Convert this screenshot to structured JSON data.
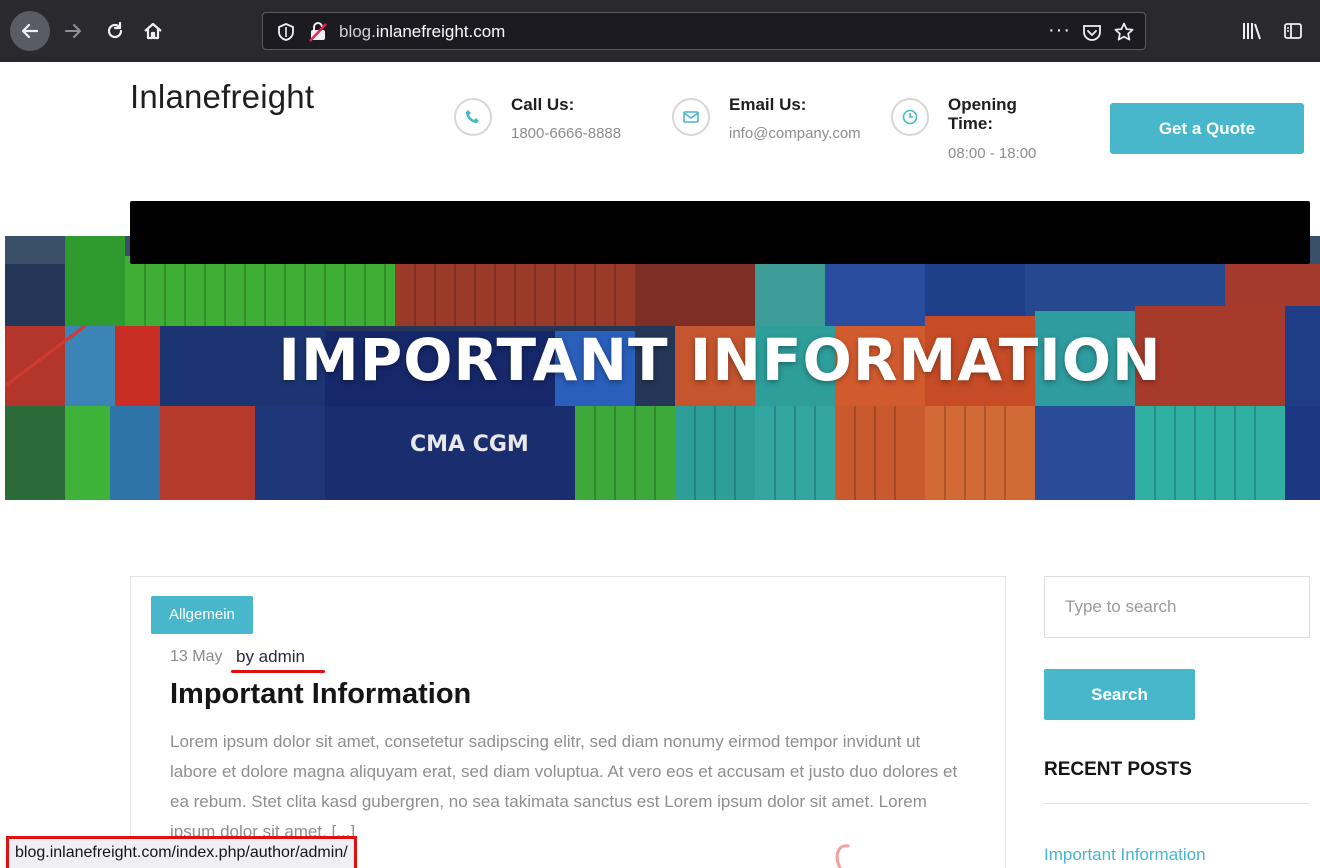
{
  "browser": {
    "url_prefix": "blog.",
    "url_domain": "inlanefreight.com",
    "more_label": "···"
  },
  "site": {
    "brand": "Inlanefreight",
    "contact": [
      {
        "title": "Call Us:",
        "value": "1800-6666-8888",
        "icon": "phone-icon"
      },
      {
        "title": "Email Us:",
        "value": "info@company.com",
        "icon": "mail-icon"
      },
      {
        "title": "Opening Time:",
        "value": "08:00 - 18:00",
        "icon": "clock-icon"
      }
    ],
    "quote_label": "Get a Quote"
  },
  "hero": {
    "title": "IMPORTANT INFORMATION",
    "container_text": "CMA CGM"
  },
  "post": {
    "category": "Allgemein",
    "date": "13 May",
    "author": "by admin",
    "title": "Important Information",
    "excerpt": "Lorem ipsum dolor sit amet, consetetur sadipscing elitr, sed diam nonumy eirmod tempor invidunt ut labore et dolore magna aliquyam erat, sed diam voluptua. At vero eos et accusam et justo duo dolores et ea rebum. Stet clita kasd gubergren, no sea takimata sanctus est Lorem ipsum dolor sit amet. Lorem ipsum dolor sit amet, [...]"
  },
  "sidebar": {
    "search_placeholder": "Type to search",
    "search_label": "Search",
    "recent_heading": "RECENT POSTS",
    "recent_posts": [
      "Important Information"
    ]
  },
  "status": {
    "link_url": "blog.inlanefreight.com/index.php/author/admin/"
  },
  "colors": {
    "accent": "#48b6cb",
    "highlight": "#e01010",
    "toolbar": "#2a2a2e"
  }
}
